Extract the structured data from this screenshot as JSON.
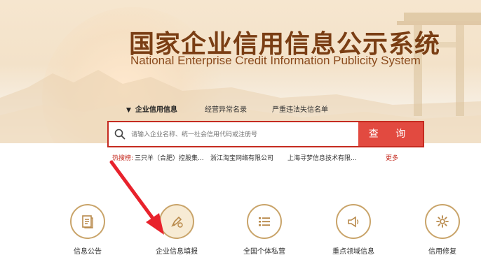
{
  "header": {
    "title_cn": "国家企业信用信息公示系统",
    "title_en": "National Enterprise Credit Information Publicity System"
  },
  "tabs": [
    {
      "label": "企业信用信息",
      "active": true
    },
    {
      "label": "经营异常名录",
      "active": false
    },
    {
      "label": "严重违法失信名单",
      "active": false
    }
  ],
  "search": {
    "placeholder": "请输入企业名称、统一社会信用代码或注册号",
    "button_label": "查 询"
  },
  "hot_search": {
    "label": "热搜榜:",
    "items": [
      "三只羊（合肥）控股集...",
      "浙江淘宝网络有限公司",
      "上海寻梦信息技术有限..."
    ],
    "more_label": "更多"
  },
  "nav": [
    {
      "label": "信息公告",
      "icon": "document-icon"
    },
    {
      "label": "企业信息填报",
      "icon": "pen-icon"
    },
    {
      "label": "全国个体私营",
      "icon": "list-icon"
    },
    {
      "label": "重点领域信息",
      "icon": "megaphone-icon"
    },
    {
      "label": "信用修复",
      "icon": "gear-icon"
    }
  ],
  "colors": {
    "accent": "#c52b20",
    "button": "#e24a40",
    "title": "#7a3e14",
    "icon_ring": "#c9a46a"
  }
}
